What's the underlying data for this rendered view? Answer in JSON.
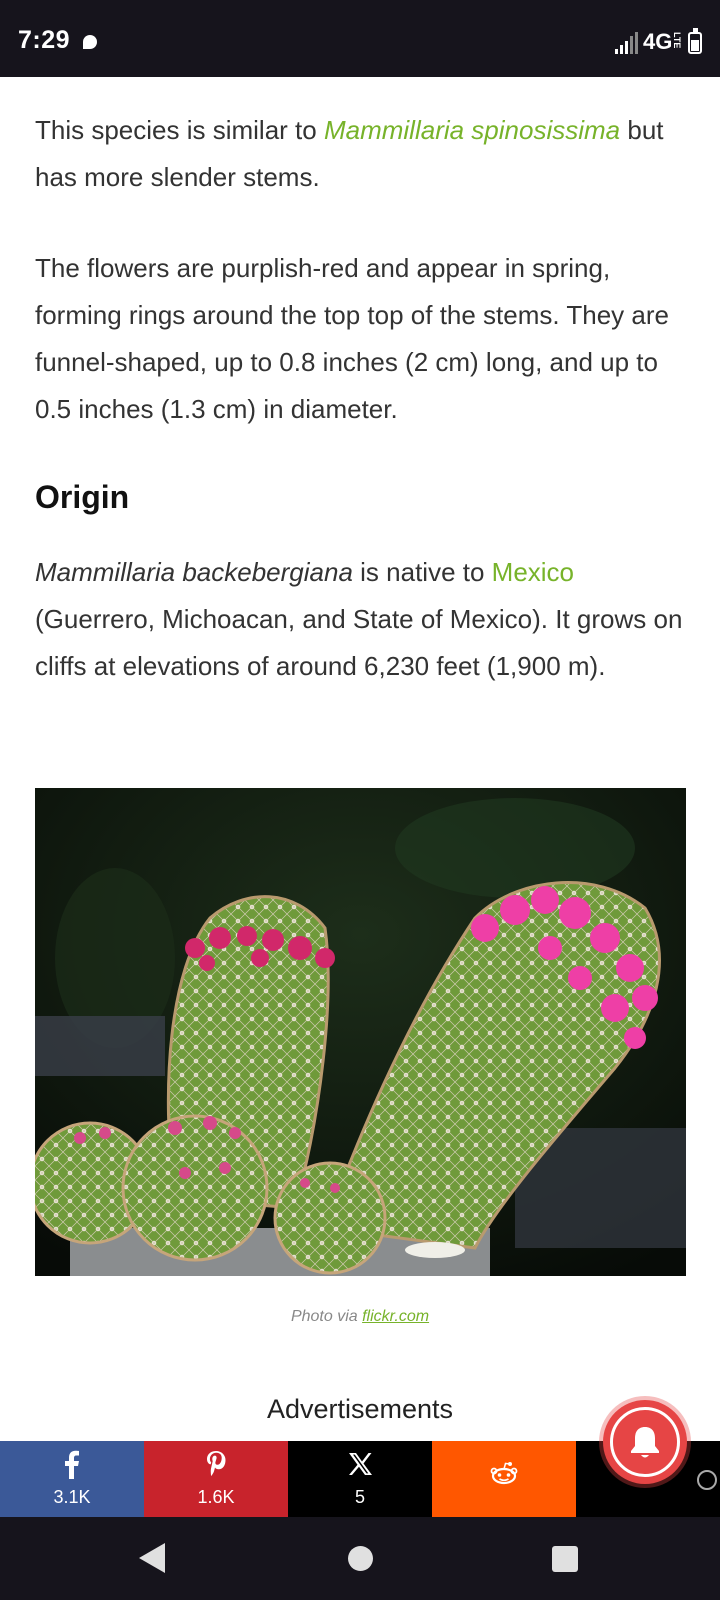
{
  "status_bar": {
    "time": "7:29",
    "network": "4G",
    "network_sub": "LTE"
  },
  "article": {
    "p1": {
      "before": "This species is similar to ",
      "link": "Mammillaria spinosissima",
      "after": " but has more slender stems."
    },
    "p2": "The flowers are purplish-red and appear in spring, forming rings around the top top of the stems. They are funnel-shaped, up to 0.8 inches (2 cm) long, and up to 0.5 inches (1.3 cm) in diameter.",
    "origin_heading": "Origin",
    "p3": {
      "species": "Mammillaria backebergiana",
      "mid": " is native to ",
      "link": "Mexico",
      "after": " (Guerrero, Michoacan, and State of Mexico). It grows on cliffs at elevations of around 6,230 feet (1,900 m)."
    },
    "caption": {
      "prefix": "Photo via ",
      "link": "flickr.com"
    },
    "ads_label": "Advertisements"
  },
  "share_bar": {
    "facebook": {
      "icon": "facebook-icon",
      "count": "3.1K",
      "color": "#3b5998"
    },
    "pinterest": {
      "icon": "pinterest-icon",
      "count": "1.6K",
      "color": "#c8232c"
    },
    "x": {
      "icon": "x-icon",
      "count": "5",
      "color": "#000000"
    },
    "reddit": {
      "icon": "reddit-icon",
      "color": "#ff5700"
    }
  },
  "colors": {
    "link": "#77b32a",
    "bell": "#e64545",
    "system_bar": "#16141c"
  }
}
